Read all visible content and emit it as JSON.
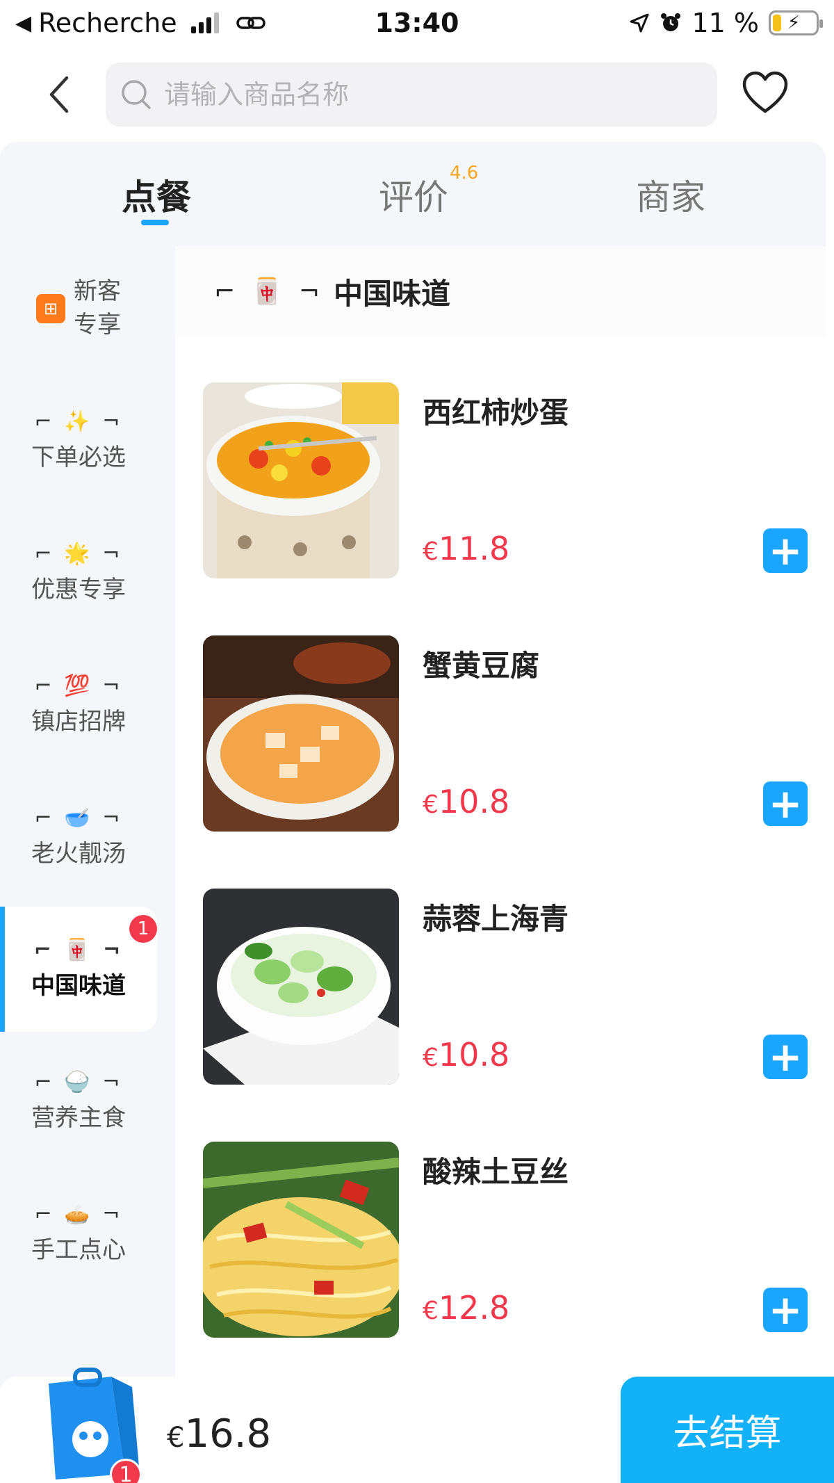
{
  "status_bar": {
    "back_app": "Recherche",
    "time": "13:40",
    "battery": "11 %"
  },
  "search": {
    "placeholder": "请输入商品名称"
  },
  "tabs": [
    {
      "label": "点餐",
      "active": true
    },
    {
      "label": "评价",
      "rating": "4.6"
    },
    {
      "label": "商家"
    }
  ],
  "sidebar": {
    "items": [
      {
        "label_line1": "新客",
        "label_line2": "专享"
      },
      {
        "deco": "⌐ ✨ ¬",
        "label": "下单必选"
      },
      {
        "deco": "⌐ 🌟 ¬",
        "label": "优惠专享"
      },
      {
        "deco": "⌐ 💯 ¬",
        "label": "镇店招牌"
      },
      {
        "deco": "⌐ 🥣 ¬",
        "label": "老火靓汤"
      },
      {
        "deco": "⌐ 🀄 ¬",
        "label": "中国味道",
        "badge": "1",
        "active": true
      },
      {
        "deco": "⌐ 🍚 ¬",
        "label": "营养主食"
      },
      {
        "deco": "⌐ 🥧 ¬",
        "label": "手工点心"
      }
    ]
  },
  "section": {
    "deco_left": "⌐ 🀄 ¬",
    "title": "中国味道"
  },
  "items": [
    {
      "name": "西红柿炒蛋",
      "currency": "€",
      "price": "11.8"
    },
    {
      "name": "蟹黄豆腐",
      "currency": "€",
      "price": "10.8"
    },
    {
      "name": "蒜蓉上海青",
      "currency": "€",
      "price": "10.8"
    },
    {
      "name": "酸辣土豆丝",
      "currency": "€",
      "price": "12.8"
    }
  ],
  "cart": {
    "badge": "1",
    "currency": "€",
    "total": "16.8",
    "checkout_label": "去结算"
  },
  "colors": {
    "accent": "#1aa6ff",
    "price": "#f2394b",
    "rating": "#f5a623"
  }
}
